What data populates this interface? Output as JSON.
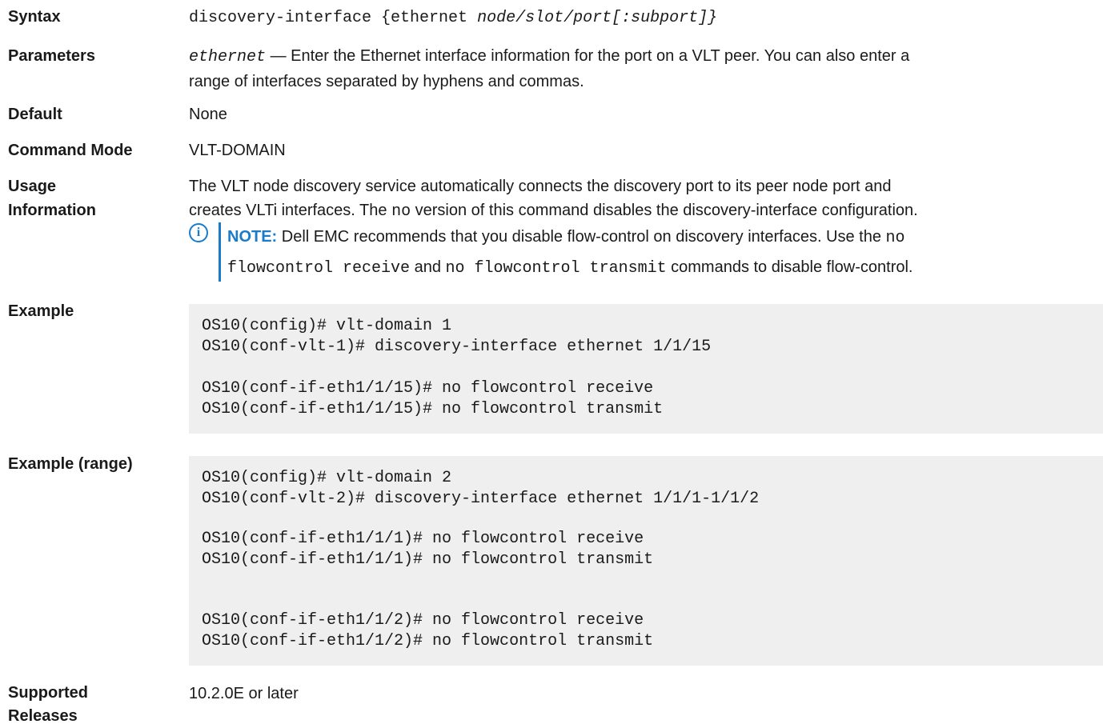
{
  "syntax": {
    "label": "Syntax",
    "command": "discovery-interface {ethernet ",
    "args": "node/slot/port[:subport]}"
  },
  "parameters": {
    "label": "Parameters",
    "param": "ethernet",
    "desc_line1": " — Enter the Ethernet interface information for the port on a VLT peer. You can also enter a",
    "desc_line2": "range of interfaces separated by hyphens and commas."
  },
  "default": {
    "label": "Default",
    "value": "None"
  },
  "command_mode": {
    "label": "Command Mode",
    "value": "VLT-DOMAIN"
  },
  "usage": {
    "label_line1": "Usage",
    "label_line2": "Information",
    "line1": "The VLT node discovery service automatically connects the discovery port to its peer node port and",
    "line2_a": "creates VLTi interfaces. The ",
    "line2_code": "no",
    "line2_b": " version of this command disables the discovery-interface configuration."
  },
  "note": {
    "icon": "info-icon",
    "label": "NOTE:",
    "line1_a": " Dell EMC recommends that you disable flow-control on discovery interfaces. Use the ",
    "line1_code": "no",
    "line2_code_a": "flowcontrol receive",
    "line2_and": " and ",
    "line2_code_b": "no flowcontrol transmit",
    "line2_b": " commands to disable flow-control."
  },
  "example": {
    "label": "Example",
    "lines": [
      "OS10(config)# vlt-domain 1",
      "OS10(conf-vlt-1)# discovery-interface ethernet 1/1/15",
      "",
      "OS10(conf-if-eth1/1/15)# no flowcontrol receive",
      "OS10(conf-if-eth1/1/15)# no flowcontrol transmit"
    ]
  },
  "example_range": {
    "label": "Example (range)",
    "lines": [
      "OS10(config)# vlt-domain 2",
      "OS10(conf-vlt-2)# discovery-interface ethernet 1/1/1-1/1/2",
      "",
      "OS10(conf-if-eth1/1/1)# no flowcontrol receive",
      "OS10(conf-if-eth1/1/1)# no flowcontrol transmit",
      "",
      "",
      "OS10(conf-if-eth1/1/2)# no flowcontrol receive",
      "OS10(conf-if-eth1/1/2)# no flowcontrol transmit"
    ]
  },
  "supported": {
    "label_line1": "Supported",
    "label_line2": "Releases",
    "value": "10.2.0E or later"
  },
  "colors": {
    "note_accent": "#1a7bc9",
    "code_background": "#efefef"
  }
}
